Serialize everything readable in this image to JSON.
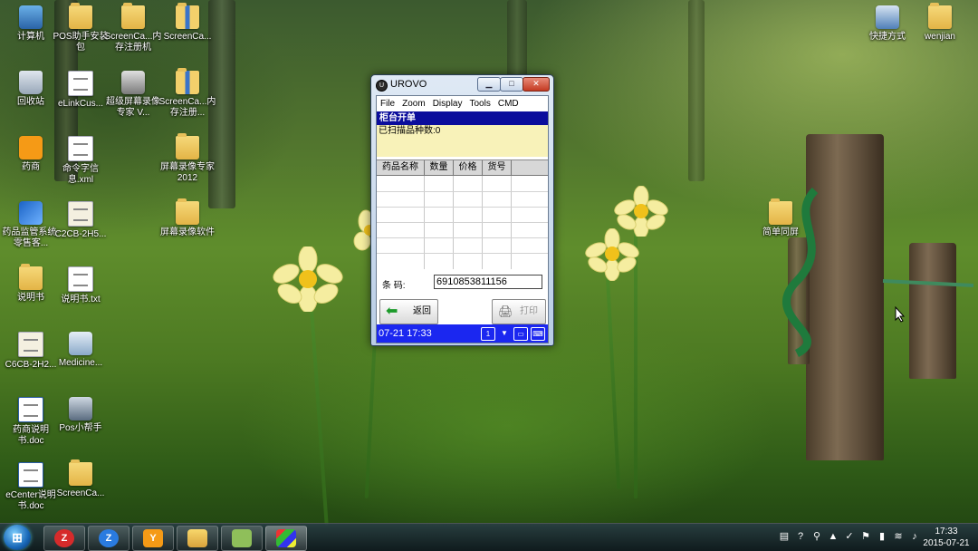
{
  "desktop_icons": [
    {
      "label": "计算机",
      "icon": "computer-icon"
    },
    {
      "label": "POS助手安装包",
      "icon": "folder-icon"
    },
    {
      "label": "ScreenCa...内存注册机",
      "icon": "folder-icon"
    },
    {
      "label": "ScreenCa...",
      "icon": "archive-icon"
    },
    {
      "label": "回收站",
      "icon": "recycle-bin-icon"
    },
    {
      "label": "eLinkCus...",
      "icon": "setup-icon"
    },
    {
      "label": "超级屏幕录像专家 V...",
      "icon": "recorder-icon"
    },
    {
      "label": "ScreenCa...内存注册...",
      "icon": "archive-icon"
    },
    {
      "label": "药商",
      "icon": "pharmacy-app-icon"
    },
    {
      "label": "命令字信息.xml",
      "icon": "xml-file-icon"
    },
    {
      "label": "屏幕录像专家2012",
      "icon": "folder-icon"
    },
    {
      "label": "药品监管系统-零售客...",
      "icon": "drug-supervision-icon"
    },
    {
      "label": "C2CB-2H5...",
      "icon": "certificate-icon"
    },
    {
      "label": "屏幕录像软件",
      "icon": "folder-icon"
    },
    {
      "label": "说明书",
      "icon": "folder-icon"
    },
    {
      "label": "说明书.txt",
      "icon": "text-file-icon"
    },
    {
      "label": "C6CB-2H2...",
      "icon": "certificate-icon"
    },
    {
      "label": "Medicine...",
      "icon": "medicine-app-icon"
    },
    {
      "label": "药商说明书.doc",
      "icon": "word-doc-icon"
    },
    {
      "label": "Pos小帮手",
      "icon": "pos-helper-icon"
    },
    {
      "label": "eCenter说明书.doc",
      "icon": "word-doc-icon"
    },
    {
      "label": "ScreenCa...",
      "icon": "folder-icon"
    },
    {
      "label": "快捷方式",
      "icon": "shortcut-icon"
    },
    {
      "label": "wenjian",
      "icon": "folder-icon"
    },
    {
      "label": "简单同屏",
      "icon": "folder-icon"
    }
  ],
  "device_window": {
    "title": "UROVO",
    "menu": [
      "File",
      "Zoom",
      "Display",
      "Tools",
      "CMD"
    ],
    "header": "柜台开单",
    "scanned_text": "已扫描品种数:0",
    "columns": [
      "药品名称",
      "数量",
      "价格",
      "货号"
    ],
    "barcode_label": "条    码:",
    "barcode_value": "6910853811156",
    "back_label": "返回",
    "print_label": "打印",
    "status_time": "07-21 17:33"
  },
  "taskbar": {
    "apps": [
      "z-app-red-icon",
      "z-app-blue-icon",
      "pharmacy-taskbar-icon",
      "explorer-icon",
      "notes-icon",
      "emulator-icon"
    ],
    "time": "17:33",
    "date": "2015-07-21"
  },
  "colors": {
    "device_header_blue": "#0b0d9c",
    "device_status_blue": "#1b27f0",
    "device_info_yellow": "#f8f2b9"
  }
}
